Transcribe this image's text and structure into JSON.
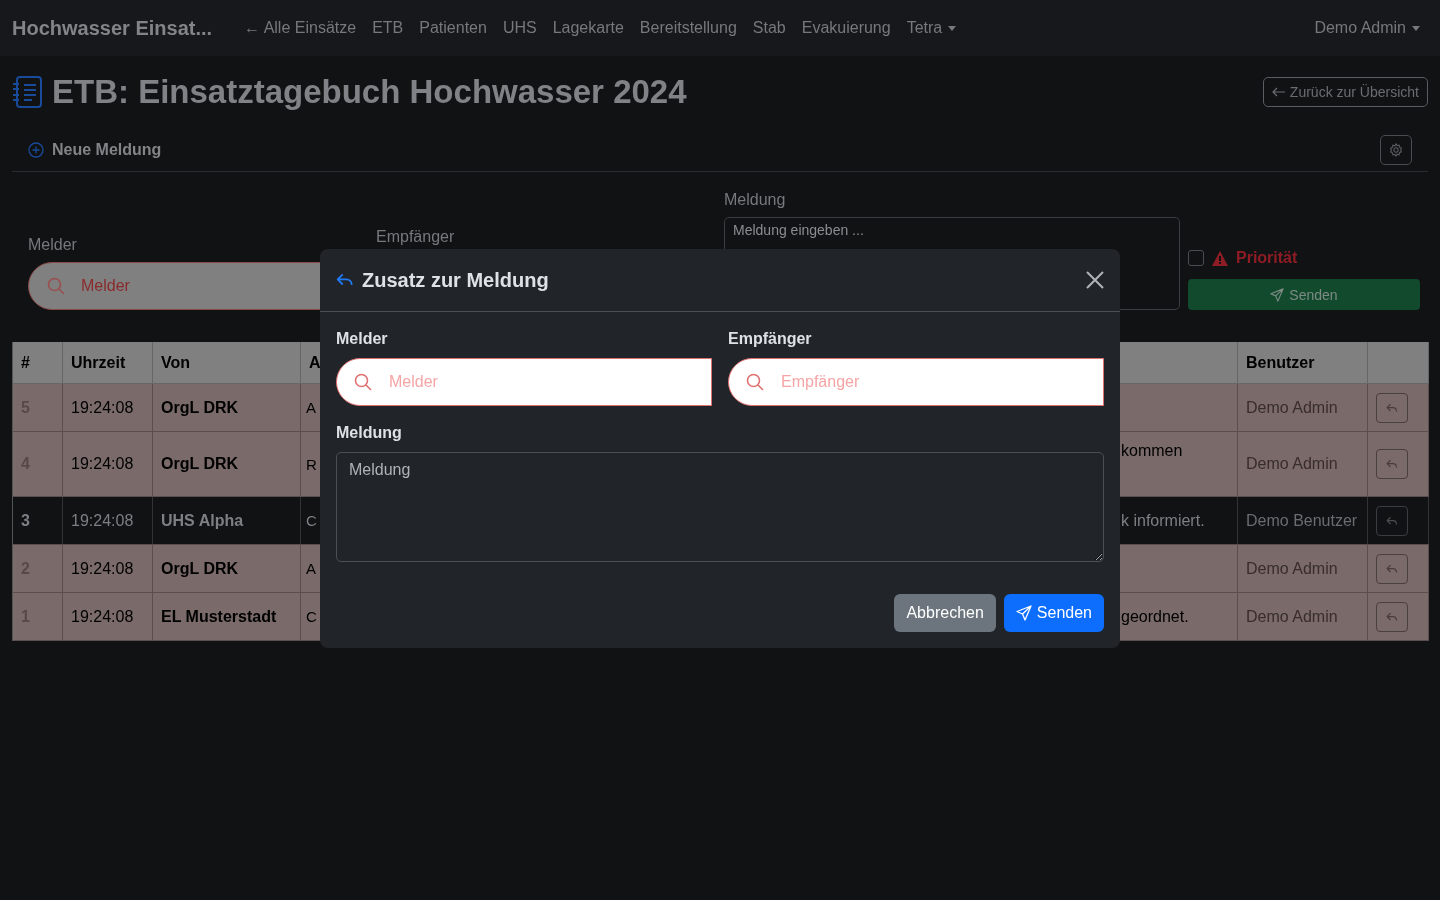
{
  "navbar": {
    "brand": "Hochwasser Einsat...",
    "items": [
      {
        "label": "← Alle Einsätze",
        "dropdown": false
      },
      {
        "label": "ETB",
        "dropdown": false
      },
      {
        "label": "Patienten",
        "dropdown": false
      },
      {
        "label": "UHS",
        "dropdown": false
      },
      {
        "label": "Lagekarte",
        "dropdown": false
      },
      {
        "label": "Bereitstellung",
        "dropdown": false
      },
      {
        "label": "Stab",
        "dropdown": false
      },
      {
        "label": "Evakuierung",
        "dropdown": false
      },
      {
        "label": "Tetra",
        "dropdown": true
      }
    ],
    "user": "Demo Admin"
  },
  "page": {
    "title": "ETB: Einsatztagebuch Hochwasser 2024",
    "back_button": "Zurück zur Übersicht"
  },
  "new_message": {
    "header": "Neue Meldung",
    "melder": {
      "label": "Melder",
      "placeholder": "Melder"
    },
    "empfaenger": {
      "label": "Empfänger"
    },
    "meldung": {
      "label": "Meldung",
      "placeholder": "Meldung eingeben ..."
    },
    "priority": {
      "label": "Priorität",
      "checked": false
    },
    "send_button": "Senden"
  },
  "table": {
    "columns": [
      "#",
      "Uhrzeit",
      "Von",
      "A",
      "",
      "Benutzer",
      ""
    ],
    "rows": [
      {
        "number": "5",
        "time": "19:24:08",
        "from": "OrgL DRK",
        "column_4": "A",
        "column_5": "",
        "user": "Demo Admin",
        "priority": true
      },
      {
        "number": "4",
        "time": "19:24:08",
        "from": "OrgL DRK",
        "column_4": "R",
        "column_5": "kommen",
        "user": "Demo Admin",
        "priority": true
      },
      {
        "number": "3",
        "time": "19:24:08",
        "from": "UHS Alpha",
        "column_4": "C",
        "column_5": "k informiert.",
        "user": "Demo Benutzer",
        "priority": false
      },
      {
        "number": "2",
        "time": "19:24:08",
        "from": "OrgL DRK",
        "column_4": "A",
        "column_5": "",
        "user": "Demo Admin",
        "priority": true
      },
      {
        "number": "1",
        "time": "19:24:08",
        "from": "EL Musterstadt",
        "column_4": "C",
        "column_5": "geordnet.",
        "user": "Demo Admin",
        "priority": true
      }
    ]
  },
  "modal": {
    "title": "Zusatz zur Meldung",
    "melder": {
      "label": "Melder",
      "placeholder": "Melder"
    },
    "empfaenger": {
      "label": "Empfänger",
      "placeholder": "Empfänger"
    },
    "meldung": {
      "label": "Meldung",
      "placeholder": "Meldung"
    },
    "cancel_button": "Abbrechen",
    "send_button": "Senden"
  }
}
